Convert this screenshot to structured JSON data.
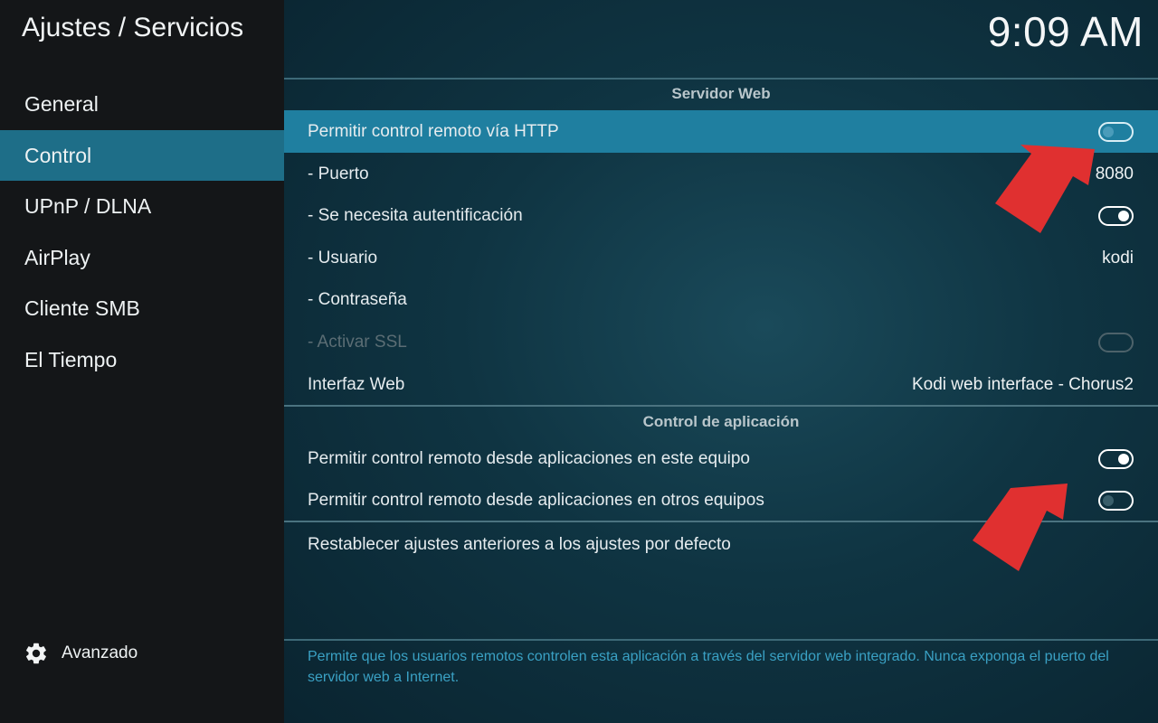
{
  "header": {
    "title": "Ajustes / Servicios",
    "clock": "9:09 AM"
  },
  "sidebar": {
    "items": [
      {
        "label": "General"
      },
      {
        "label": "Control"
      },
      {
        "label": "UPnP / DLNA"
      },
      {
        "label": "AirPlay"
      },
      {
        "label": "Cliente SMB"
      },
      {
        "label": "El Tiempo"
      }
    ],
    "active": "Control",
    "advanced_label": "Avanzado",
    "advanced_icon": "gear-icon"
  },
  "webserver": {
    "section_title": "Servidor Web",
    "rows": {
      "allow_http": {
        "label": "Permitir control remoto vía HTTP",
        "state": "off"
      },
      "port": {
        "label": "- Puerto",
        "value": "8080"
      },
      "auth": {
        "label": "- Se necesita autentificación",
        "state": "on"
      },
      "user": {
        "label": "- Usuario",
        "value": "kodi"
      },
      "password": {
        "label": "- Contraseña",
        "value": ""
      },
      "ssl": {
        "label": "- Activar SSL",
        "state": "disabled"
      },
      "web_interface": {
        "label": "Interfaz Web",
        "value": "Kodi web interface - Chorus2"
      }
    }
  },
  "appcontrol": {
    "section_title": "Control de aplicación",
    "rows": {
      "local": {
        "label": "Permitir control remoto desde aplicaciones en este equipo",
        "state": "on"
      },
      "remote": {
        "label": "Permitir control remoto desde aplicaciones en otros equipos",
        "state": "off"
      }
    }
  },
  "reset": {
    "label": "Restablecer ajustes anteriores a los ajustes por defecto"
  },
  "description": "Permite que los usuarios remotos controlen esta aplicación a través del servidor web integrado. Nunca exponga el puerto del servidor web a Internet.",
  "colors": {
    "accent": "#1f7fa0",
    "sidebar_bg": "#141618",
    "description_text": "#3aa1c4",
    "annotation_arrow": "#e03030"
  }
}
